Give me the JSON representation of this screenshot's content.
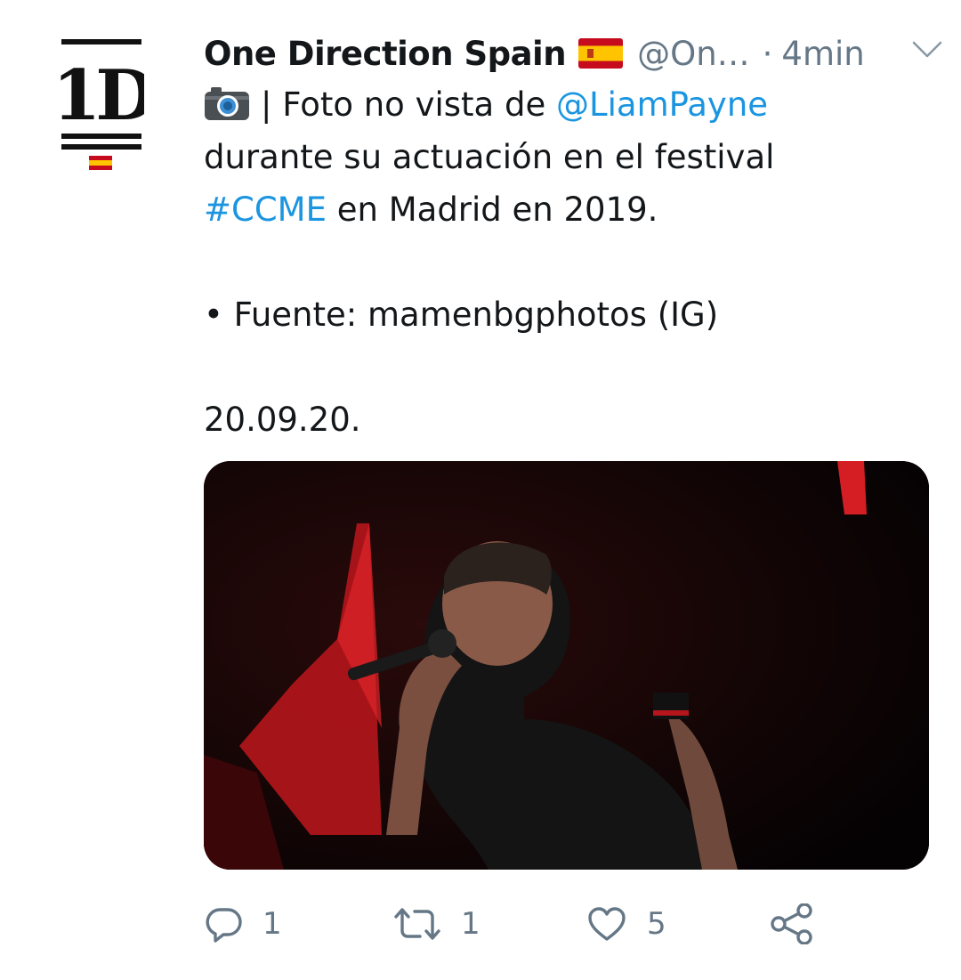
{
  "tweet": {
    "display_name": "One Direction Spain",
    "handle": "@On…",
    "separator": "·",
    "time": "4min",
    "body": {
      "line1_separator": "| Foto no vista de ",
      "mention": "@LiamPayne",
      "line2": "durante su actuación en el festival",
      "hashtag": "#CCME",
      "line3_rest": " en Madrid en 2019.",
      "source": "• Fuente: mamenbgphotos (IG)",
      "date": "20.09.20."
    },
    "actions": {
      "replies": "1",
      "retweets": "1",
      "likes": "5"
    }
  },
  "avatar": {
    "logo_text": "1D"
  },
  "icons": {
    "avatar": "one-direction-logo",
    "flag": "spain-flag-icon",
    "menu": "chevron-down-icon",
    "camera": "camera-icon",
    "reply": "reply-icon",
    "retweet": "retweet-icon",
    "like": "heart-icon",
    "share": "share-icon"
  },
  "colors": {
    "link": "#1b95e0",
    "secondary_text": "#657786",
    "primary_text": "#14171a"
  }
}
